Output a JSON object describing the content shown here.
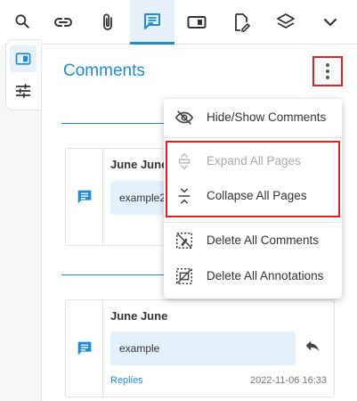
{
  "colors": {
    "accent": "#1f8bd8",
    "highlight_red": "#e02020",
    "bubble_bg": "#e3f1fc"
  },
  "rail": {
    "search_icon": "search-icon",
    "items": [
      {
        "icon": "sidebar-panel-icon",
        "active": true
      },
      {
        "icon": "sliders-icon",
        "active": false
      }
    ]
  },
  "toolbar": {
    "buttons": [
      {
        "icon": "link-icon"
      },
      {
        "icon": "paperclip-icon"
      },
      {
        "icon": "comment-icon",
        "active": true
      },
      {
        "icon": "form-field-icon"
      },
      {
        "icon": "signature-icon"
      },
      {
        "icon": "layers-icon"
      },
      {
        "icon": "chevron-down-icon"
      }
    ]
  },
  "panel": {
    "title": "Comments",
    "more_icon": "more-vertical-icon"
  },
  "comments": [
    {
      "author": "June June",
      "text": "example2"
    },
    {
      "author": "June June",
      "text": "example",
      "replies_label": "Replies",
      "timestamp": "2022-11-06 16:33"
    }
  ],
  "menu": {
    "items": [
      {
        "label": "Hide/Show Comments",
        "icon": "eye-off-icon",
        "enabled": true
      },
      {
        "label": "Expand All Pages",
        "icon": "expand-icon",
        "enabled": false
      },
      {
        "label": "Collapse All Pages",
        "icon": "collapse-icon",
        "enabled": true
      },
      {
        "label": "Delete All Comments",
        "icon": "delete-comments-icon",
        "enabled": true
      },
      {
        "label": "Delete All Annotations",
        "icon": "delete-annotations-icon",
        "enabled": true
      }
    ]
  }
}
